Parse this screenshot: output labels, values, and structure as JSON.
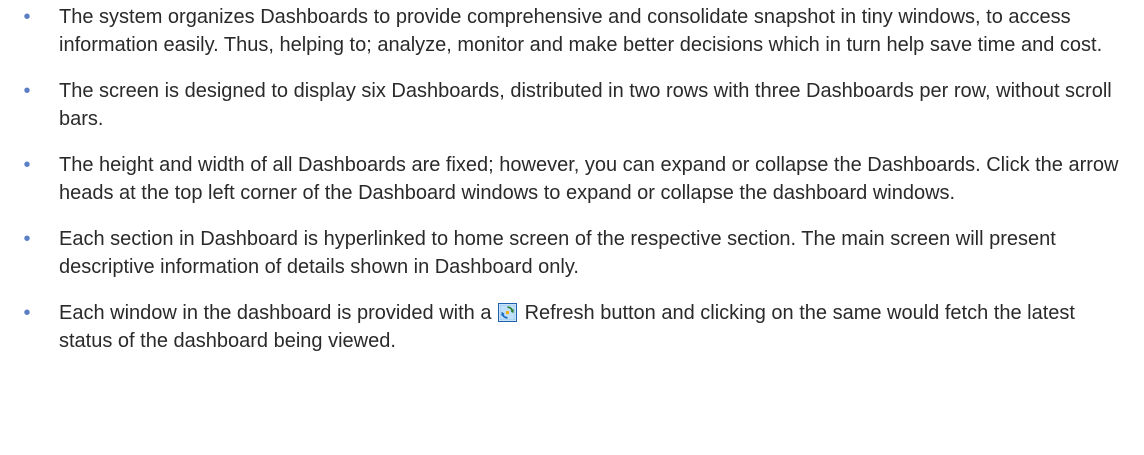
{
  "bullets": [
    {
      "text": "The system organizes Dashboards to provide comprehensive and consolidate snapshot in tiny windows, to access information easily. Thus, helping to; analyze, monitor and make better decisions which in turn help save time and cost."
    },
    {
      "text": "The screen is designed to display six Dashboards, distributed in two rows with three Dashboards per row, without scroll bars."
    },
    {
      "text": "The height and width of all Dashboards are fixed; however, you can expand or collapse the Dashboards. Click the arrow heads at the top left corner of the Dashboard windows to expand or collapse the dashboard windows."
    },
    {
      "text": "Each section in Dashboard is hyperlinked to home screen of the respective section. The main screen will present descriptive information of details shown in Dashboard only."
    },
    {
      "before_icon": "Each window in the dashboard is provided with a",
      "icon": "refresh-icon",
      "after_icon": "Refresh button and clicking on the same would fetch the latest status of the dashboard being viewed."
    }
  ],
  "bullet_glyph": "•",
  "colors": {
    "text": "#2a2a2a",
    "bullet": "#5b7fc4",
    "icon_border": "#1f5fb0",
    "icon_fill": "#bfe0fa"
  }
}
